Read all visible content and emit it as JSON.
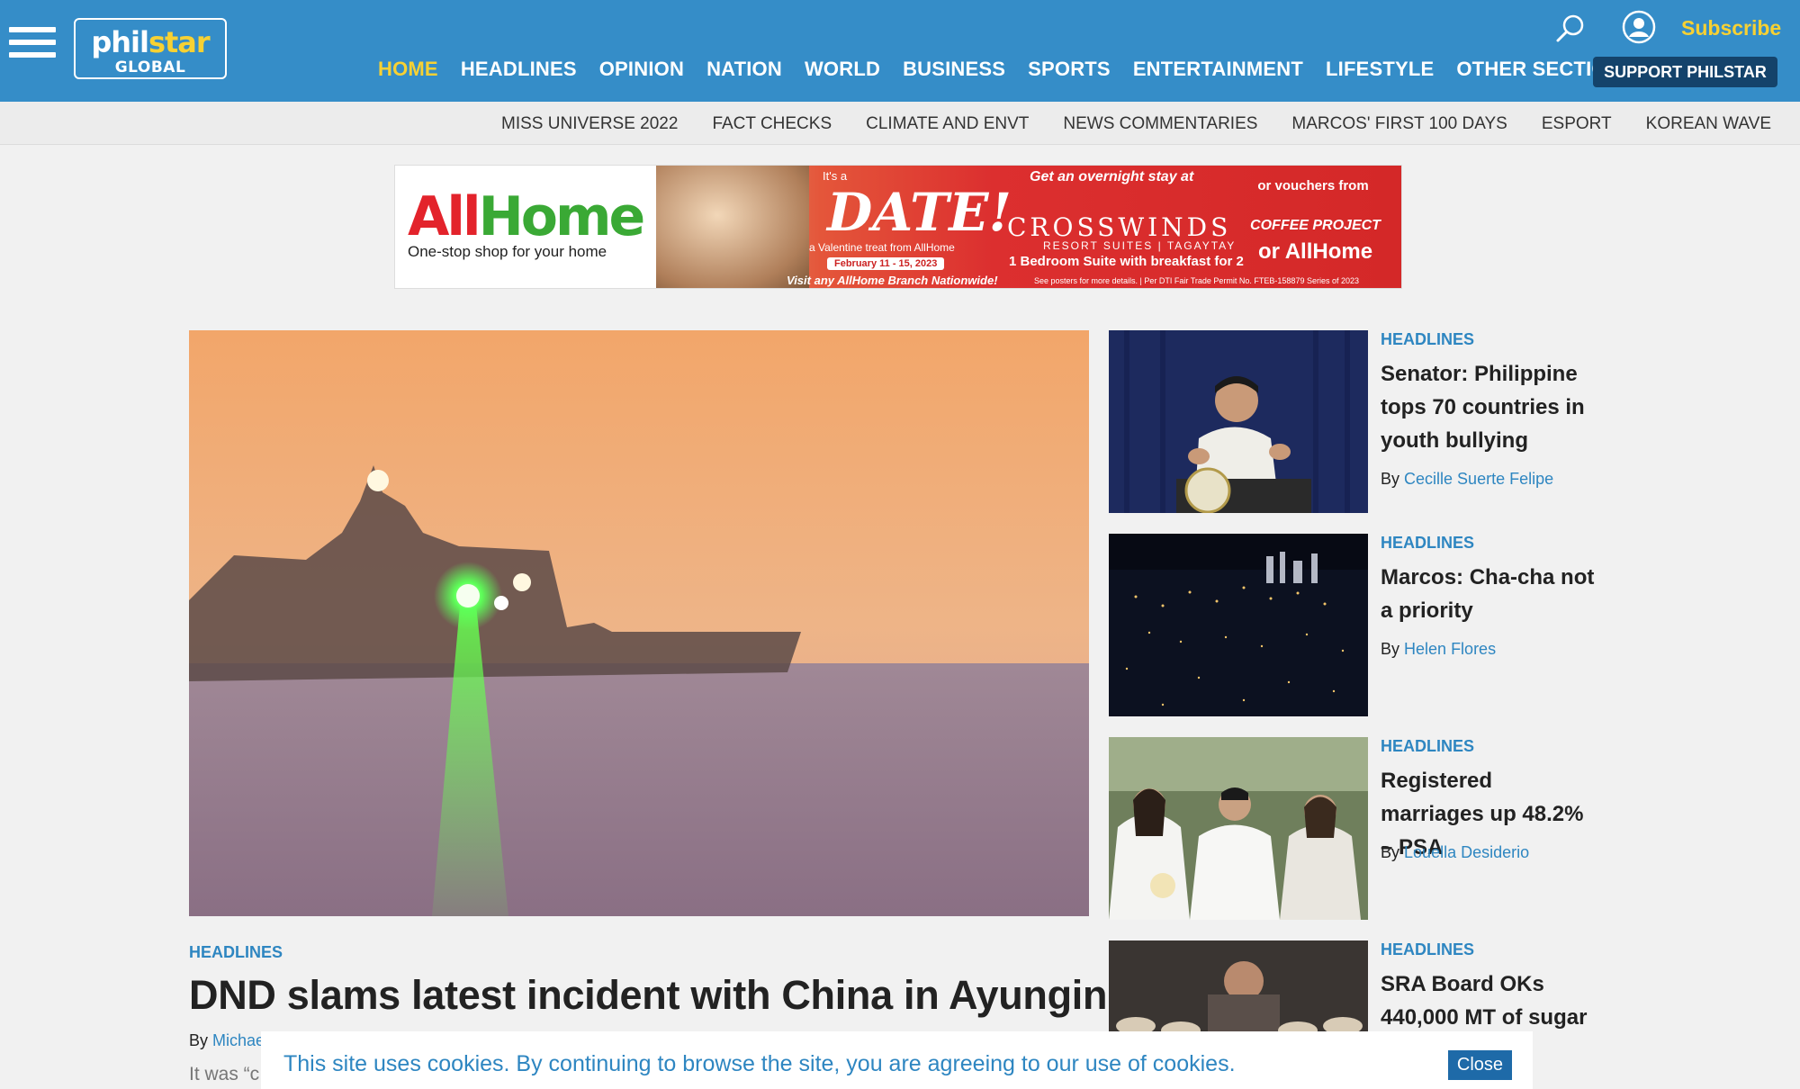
{
  "header": {
    "logo_top": "philstar",
    "logo_top_a": "phil",
    "logo_top_b": "star",
    "logo_bottom": "GLOBAL",
    "subscribe": "Subscribe",
    "support": "SUPPORT PHILSTAR",
    "colors": {
      "bar": "#358dc8",
      "accent": "#f7d133",
      "support_bg": "#14436b"
    }
  },
  "nav": {
    "main": [
      "HOME",
      "HEADLINES",
      "OPINION",
      "NATION",
      "WORLD",
      "BUSINESS",
      "SPORTS",
      "ENTERTAINMENT",
      "LIFESTYLE",
      "OTHER SECTIONS"
    ],
    "active": "HOME",
    "secondary": [
      "MISS UNIVERSE 2022",
      "FACT CHECKS",
      "CLIMATE AND ENVT",
      "NEWS COMMENTARIES",
      "MARCOS' FIRST 100 DAYS",
      "ESPORT",
      "KOREAN WAVE"
    ]
  },
  "ad": {
    "brand_a": "All",
    "brand_b": "Home",
    "tagline": "One-stop shop for your home",
    "its_a": "It's a",
    "date": "DATE!",
    "valentine": "a Valentine treat from AllHome",
    "dates": "February 11 - 15, 2023",
    "visit": "Visit any AllHome Branch Nationwide!",
    "overnight": "Get an overnight stay at",
    "crosswinds": "CROSSWINDS",
    "resort": "RESORT SUITES | TAGAYTAY",
    "suite": "1 Bedroom Suite with breakfast for 2",
    "vouchers": "or vouchers from",
    "coffee": "COFFEE PROJECT",
    "or_allhome": "or AllHome",
    "fine_print": "See posters for more details. | Per DTI Fair Trade Permit No. FTEB-158879 Series of 2023"
  },
  "main_story": {
    "category": "HEADLINES",
    "title": "DND slams latest incident with China in Ayungin",
    "by_prefix": "By",
    "author": "Michae",
    "excerpt": "It was “c"
  },
  "side_stories": [
    {
      "category": "HEADLINES",
      "title": "Senator: Philippine tops 70 countries in youth bullying",
      "by_prefix": "By",
      "author": "Cecille Suerte Felipe"
    },
    {
      "category": "HEADLINES",
      "title": "Marcos: Cha-cha not a priority",
      "by_prefix": "By",
      "author": "Helen Flores"
    },
    {
      "category": "HEADLINES",
      "title": "Registered marriages up 48.2% – PSA",
      "by_prefix": "By",
      "author": "Louella Desiderio"
    },
    {
      "category": "HEADLINES",
      "title": "SRA Board OKs 440,000 MT of sugar",
      "by_prefix": "",
      "author": ""
    }
  ],
  "cookie": {
    "text": "This site uses cookies. By continuing to browse the site, you are agreeing to our use of cookies.",
    "close": "Close"
  },
  "icons": [
    "menu-icon",
    "search-icon",
    "user-icon"
  ]
}
